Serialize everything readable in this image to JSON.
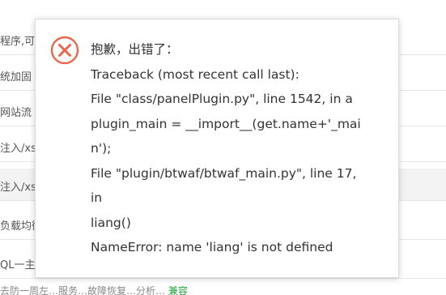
{
  "background": {
    "rows": [
      "程序,可",
      "统加固",
      "网站流",
      "注入/xss",
      "注入/xss",
      "负载均衡",
      "QL一主"
    ],
    "bottom_prefix": "去防一周左…服务…故障恢复…分析…",
    "bottom_link": "兼容"
  },
  "dialog": {
    "icon": "error-circle-x-icon",
    "accent_color": "#e8664a",
    "lines": [
      "抱歉，出错了：",
      "Traceback (most recent call last):",
      "File \"class/panelPlugin.py\", line 1542, in a",
      "plugin_main = __import__(get.name+'_mai",
      "n');",
      "File \"plugin/btwaf/btwaf_main.py\", line 17,",
      "in",
      "liang()",
      "NameError: name 'liang' is not defined"
    ]
  }
}
